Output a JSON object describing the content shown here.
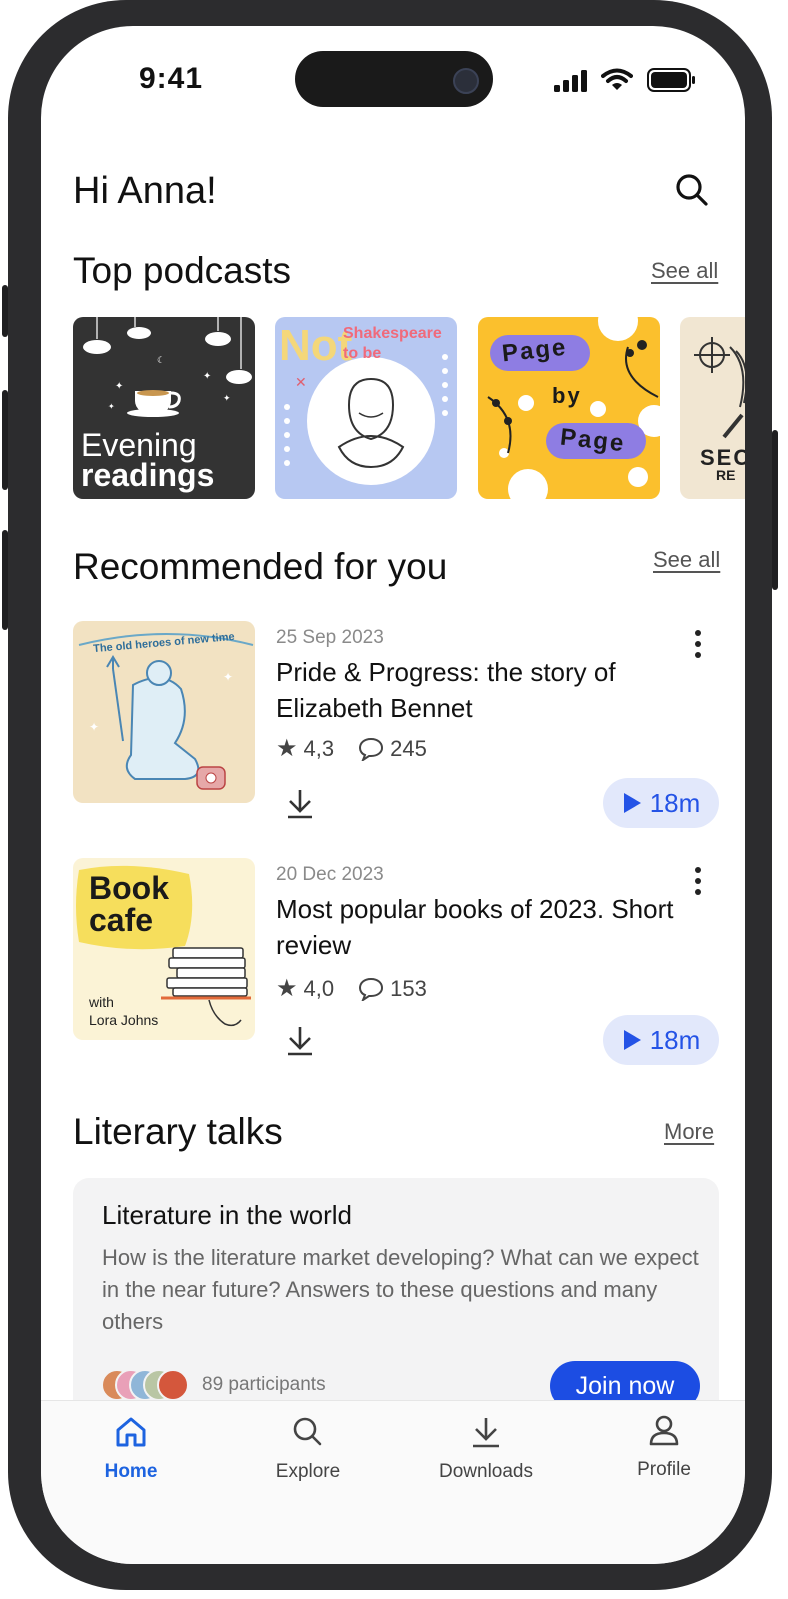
{
  "status": {
    "time": "9:41"
  },
  "header": {
    "greeting": "Hi Anna!"
  },
  "top_podcasts": {
    "title": "Top podcasts",
    "see_all": "See all",
    "covers": [
      {
        "line1": "Evening",
        "line2": "readings"
      },
      {
        "line1": "Not",
        "line2": "Shakespeare",
        "line3": "to be"
      },
      {
        "line1": "Page",
        "line2": "by",
        "line3": "Page"
      },
      {
        "line1": "SEC",
        "line2": "RE"
      }
    ]
  },
  "recommended": {
    "title": "Recommended for you",
    "see_all": "See all",
    "items": [
      {
        "date": "25 Sep 2023",
        "title": "Pride & Progress: the story of Elizabeth Bennet",
        "rating": "4,3",
        "comments": "245",
        "duration": "18m",
        "cover_text": "The old heroes of new time"
      },
      {
        "date": "20 Dec 2023",
        "title": "Most popular books of 2023. Short review",
        "rating": "4,0",
        "comments": "153",
        "duration": "18m",
        "cover_line1": "Book",
        "cover_line2": "cafe",
        "cover_with": "with",
        "cover_author": "Lora Johns"
      }
    ]
  },
  "literary_talks": {
    "title": "Literary talks",
    "more": "More",
    "card": {
      "title": "Literature in the world",
      "description": "How is the literature market developing? What can we expect in the near future? Answers to these questions and many others",
      "participants": "89 participants",
      "join_label": "Join now"
    }
  },
  "tabbar": {
    "items": [
      {
        "label": "Home",
        "icon": "home-icon",
        "active": true
      },
      {
        "label": "Explore",
        "icon": "search-icon",
        "active": false
      },
      {
        "label": "Downloads",
        "icon": "download-icon",
        "active": false
      },
      {
        "label": "Profile",
        "icon": "profile-icon",
        "active": false
      }
    ]
  },
  "colors": {
    "accent": "#1c4de3",
    "play_pill": "#e2e8fb",
    "active_tab": "#1d63e0"
  }
}
